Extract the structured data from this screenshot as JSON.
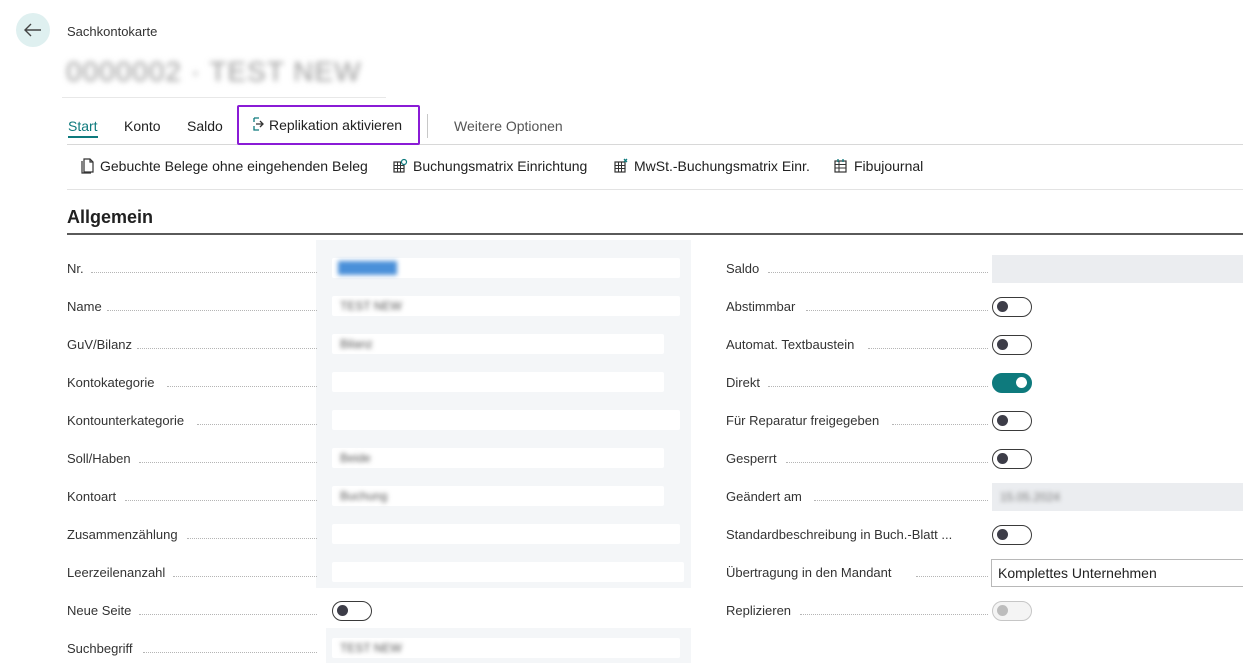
{
  "header": {
    "breadcrumb": "Sachkontokarte",
    "title_blurred": "0000002 · TEST NEW"
  },
  "tabs": [
    {
      "label": "Start",
      "active": true
    },
    {
      "label": "Konto"
    },
    {
      "label": "Saldo"
    },
    {
      "label": "Replikation aktivieren",
      "highlighted": true
    },
    {
      "label": "Weitere Optionen"
    }
  ],
  "actions": [
    {
      "label": "Gebuchte Belege ohne eingehenden Beleg",
      "icon": "document-icon"
    },
    {
      "label": "Buchungsmatrix Einrichtung",
      "icon": "matrix-setup-icon"
    },
    {
      "label": "MwSt.-Buchungsmatrix Einr.",
      "icon": "vat-matrix-icon"
    },
    {
      "label": "Fibujournal",
      "icon": "journal-icon"
    }
  ],
  "section": {
    "title": "Allgemein"
  },
  "left_fields": [
    {
      "label": "Nr.",
      "value": "0000002"
    },
    {
      "label": "Name",
      "value": "TEST NEW"
    },
    {
      "label": "GuV/Bilanz",
      "value": "Bilanz"
    },
    {
      "label": "Kontokategorie",
      "value": ""
    },
    {
      "label": "Kontounterkategorie",
      "value": ""
    },
    {
      "label": "Soll/Haben",
      "value": "Beide"
    },
    {
      "label": "Kontoart",
      "value": "Buchung"
    },
    {
      "label": "Zusammenzählung",
      "value": ""
    },
    {
      "label": "Leerzeilenanzahl",
      "value": ""
    },
    {
      "label": "Neue Seite",
      "toggle": false
    },
    {
      "label": "Suchbegriff",
      "value": "TEST NEW"
    }
  ],
  "right_fields": [
    {
      "label": "Saldo",
      "value": ""
    },
    {
      "label": "Abstimmbar",
      "toggle": false
    },
    {
      "label": "Automat. Textbaustein",
      "toggle": false
    },
    {
      "label": "Direkt",
      "toggle": true
    },
    {
      "label": "Für Reparatur freigegeben",
      "toggle": false
    },
    {
      "label": "Gesperrt",
      "toggle": false
    },
    {
      "label": "Geändert am",
      "value": "15.05.2024"
    },
    {
      "label": "Standardbeschreibung in Buch.-Blatt ...",
      "toggle": false
    },
    {
      "label": "Übertragung in den Mandant",
      "value": "Komplettes Unternehmen"
    },
    {
      "label": "Replizieren",
      "toggle": false,
      "disabled": true
    }
  ],
  "colors": {
    "accent": "#0e7a7d",
    "highlight_border": "#8a1bd6"
  }
}
